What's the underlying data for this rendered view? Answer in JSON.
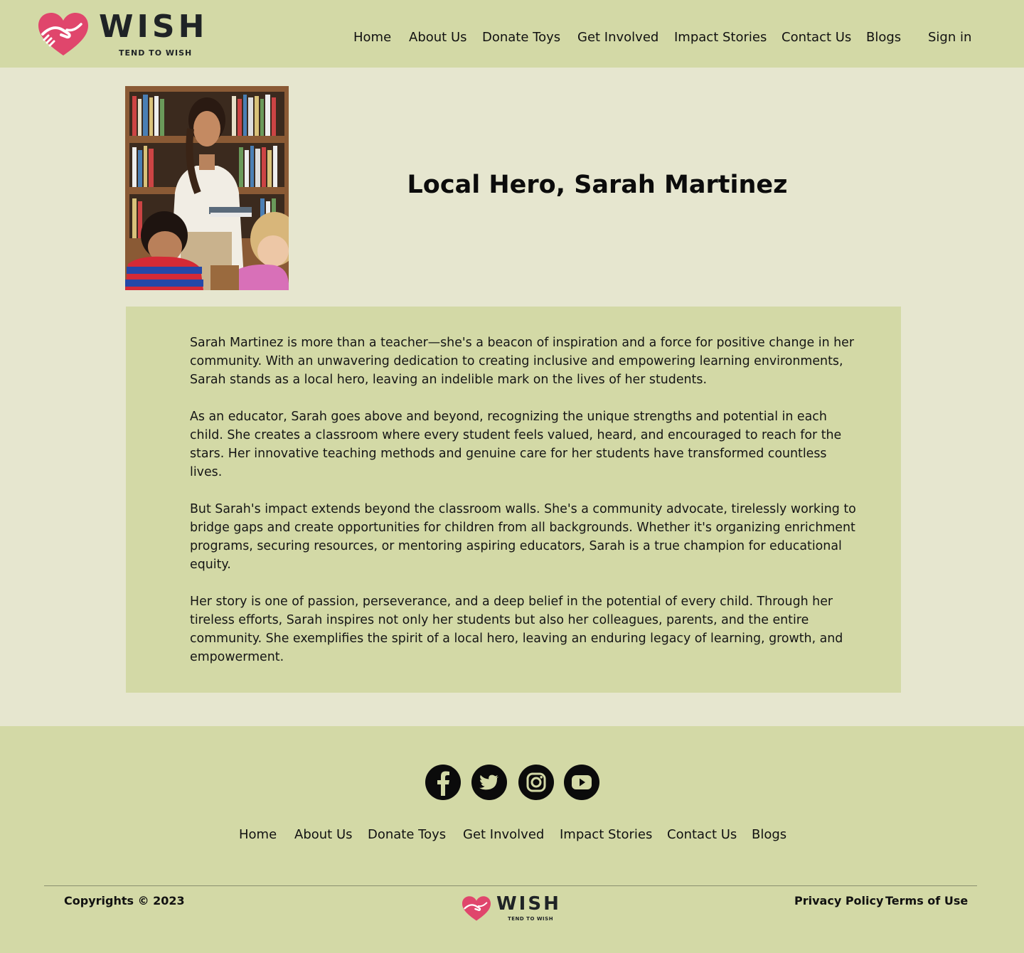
{
  "brand": {
    "name": "WISH",
    "tagline": "TEND TO WISH",
    "accent": "#e0466c",
    "header_bg": "#d3d9a6",
    "page_bg": "#e6e6cf"
  },
  "header": {
    "nav": [
      "Home",
      "About Us",
      "Donate Toys",
      "Get Involved",
      "Impact Stories",
      "Contact Us",
      "Blogs"
    ],
    "sign_in": "Sign in"
  },
  "hero": {
    "title": "Local Hero, Sarah Martinez",
    "photo_icon": "teacher-with-students-photo"
  },
  "story": {
    "paragraphs": [
      "Sarah Martinez is more than a teacher—she's a beacon of inspiration and a force for positive change in her community. With an unwavering dedication to creating inclusive and empowering learning environments, Sarah stands as a local hero, leaving an indelible mark on the lives of her students.",
      "As an educator, Sarah goes above and beyond, recognizing the unique strengths and potential in each child. She creates a classroom where every student feels valued, heard, and encouraged to reach for the stars. Her innovative teaching methods and genuine care for her students have transformed countless lives.",
      "But Sarah's impact extends beyond the classroom walls. She's a community advocate, tirelessly working to bridge gaps and create opportunities for children from all backgrounds. Whether it's organizing enrichment programs, securing resources, or mentoring aspiring educators, Sarah is a true champion for educational equity.",
      "Her story is one of passion, perseverance, and a deep belief in the potential of every child. Through her tireless efforts, Sarah inspires not only her students but also her colleagues, parents, and the entire community. She exemplifies the spirit of a local hero, leaving an enduring legacy of learning, growth, and empowerment."
    ]
  },
  "footer": {
    "social": [
      "facebook-icon",
      "twitter-icon",
      "instagram-icon",
      "youtube-icon"
    ],
    "nav": [
      "Home",
      "About Us",
      "Donate Toys",
      "Get Involved",
      "Impact Stories",
      "Contact Us",
      "Blogs"
    ],
    "copyright": "Copyrights © 2023",
    "links": [
      "Privacy Policy",
      "Terms of Use"
    ]
  }
}
